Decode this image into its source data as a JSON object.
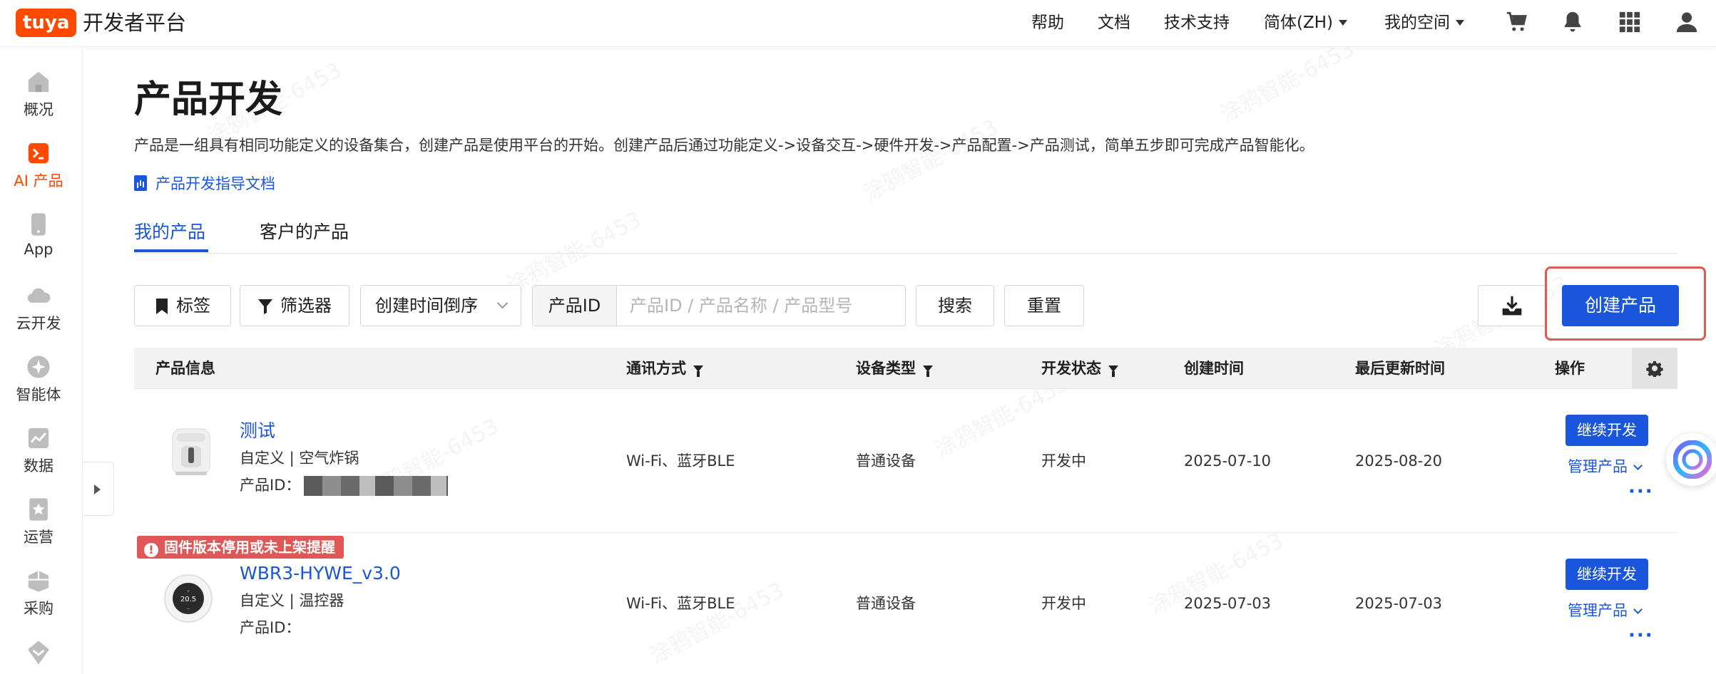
{
  "header": {
    "logo_text": "tuya",
    "platform_name": "开发者平台",
    "nav": {
      "help": "帮助",
      "docs": "文档",
      "support": "技术支持",
      "language": "简体(ZH)",
      "workspace": "我的空间"
    },
    "icons": [
      "cart-icon",
      "bell-icon",
      "apps-grid-icon",
      "user-icon"
    ]
  },
  "sidebar": {
    "items": [
      {
        "label": "概况",
        "icon": "home-icon"
      },
      {
        "label": "AI 产品",
        "icon": "terminal-icon",
        "active": true
      },
      {
        "label": "App",
        "icon": "phone-icon"
      },
      {
        "label": "云开发",
        "icon": "cloud-icon"
      },
      {
        "label": "智能体",
        "icon": "agent-icon"
      },
      {
        "label": "数据",
        "icon": "chart-icon"
      },
      {
        "label": "运营",
        "icon": "star-icon"
      },
      {
        "label": "采购",
        "icon": "box-icon"
      }
    ]
  },
  "main": {
    "title": "产品开发",
    "description": "产品是一组具有相同功能定义的设备集合，创建产品是使用平台的开始。创建产品后通过功能定义->设备交互->硬件开发->产品配置->产品测试，简单五步即可完成产品智能化。",
    "guide_link": "产品开发指导文档",
    "tabs": [
      {
        "label": "我的产品",
        "active": true
      },
      {
        "label": "客户的产品",
        "active": false
      }
    ]
  },
  "toolbar": {
    "tag_label": "标签",
    "filter_label": "筛选器",
    "sort_label": "创建时间倒序",
    "search_prefix": "产品ID",
    "search_placeholder": "产品ID / 产品名称 / 产品型号",
    "search_button": "搜索",
    "reset_button": "重置",
    "create_button": "创建产品"
  },
  "table": {
    "headers": {
      "product_info": "产品信息",
      "protocol": "通讯方式",
      "device_type": "设备类型",
      "dev_status": "开发状态",
      "created": "创建时间",
      "updated": "最后更新时间",
      "actions": "操作"
    },
    "rows": [
      {
        "name": "测试",
        "category": "自定义  |  空气炸锅",
        "id_label": "产品ID：",
        "protocol": "Wi-Fi、蓝牙BLE",
        "device_type": "普通设备",
        "status": "开发中",
        "created": "2025-07-10",
        "updated": "2025-08-20",
        "continue_label": "继续开发",
        "manage_label": "管理产品",
        "more": "···"
      },
      {
        "warning": "固件版本停用或未上架提醒",
        "name": "WBR3-HYWE_v3.0",
        "category": "自定义  |  温控器",
        "id_label": "产品ID：",
        "protocol": "Wi-Fi、蓝牙BLE",
        "device_type": "普通设备",
        "status": "开发中",
        "created": "2025-07-03",
        "updated": "2025-07-03",
        "continue_label": "继续开发",
        "manage_label": "管理产品",
        "more": "···",
        "thermostat_reading": "20.5"
      }
    ]
  },
  "watermark_text": "涂鸦智能-6453",
  "colors": {
    "brand": "#ff4800",
    "primary": "#1a56db",
    "highlight": "#e05a4f",
    "warning": "#e05757"
  }
}
